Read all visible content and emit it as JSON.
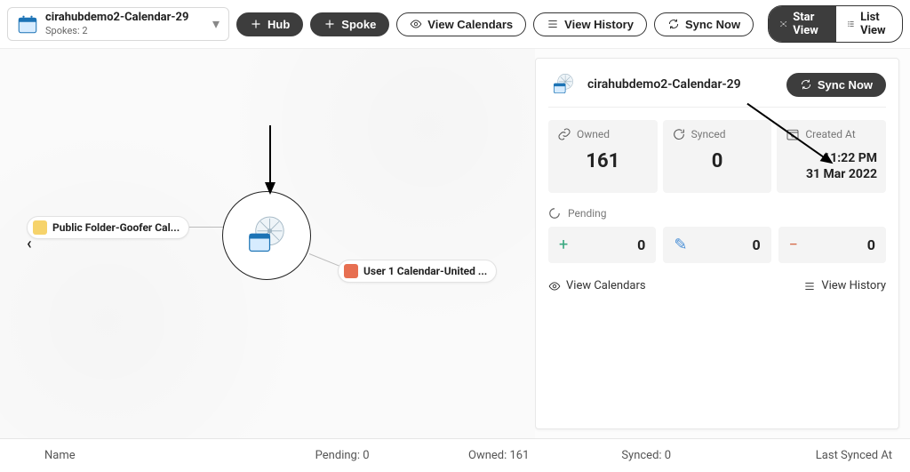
{
  "selector": {
    "title": "cirahubdemo2-Calendar-29",
    "sub": "Spokes: 2"
  },
  "toolbar": {
    "hub": "Hub",
    "spoke": "Spoke",
    "view_calendars": "View Calendars",
    "view_history": "View History",
    "sync_now": "Sync Now",
    "star_view": "Star View",
    "list_view": "List View"
  },
  "spokes": [
    {
      "label": "Public Folder-Goofer Cal..."
    },
    {
      "label": "User 1 Calendar-United ..."
    }
  ],
  "panel": {
    "title": "cirahubdemo2-Calendar-29",
    "sync_now": "Sync Now",
    "owned_label": "Owned",
    "owned_value": "161",
    "synced_label": "Synced",
    "synced_value": "0",
    "created_label": "Created At",
    "created_time": "11:22 PM",
    "created_date": "31 Mar 2022",
    "pending_label": "Pending",
    "pending_add": "0",
    "pending_edit": "0",
    "pending_remove": "0",
    "link_calendars": "View Calendars",
    "link_history": "View History"
  },
  "footer": {
    "name": "Name",
    "pending": "Pending: 0",
    "owned": "Owned: 161",
    "synced": "Synced: 0",
    "last_synced": "Last Synced At"
  }
}
